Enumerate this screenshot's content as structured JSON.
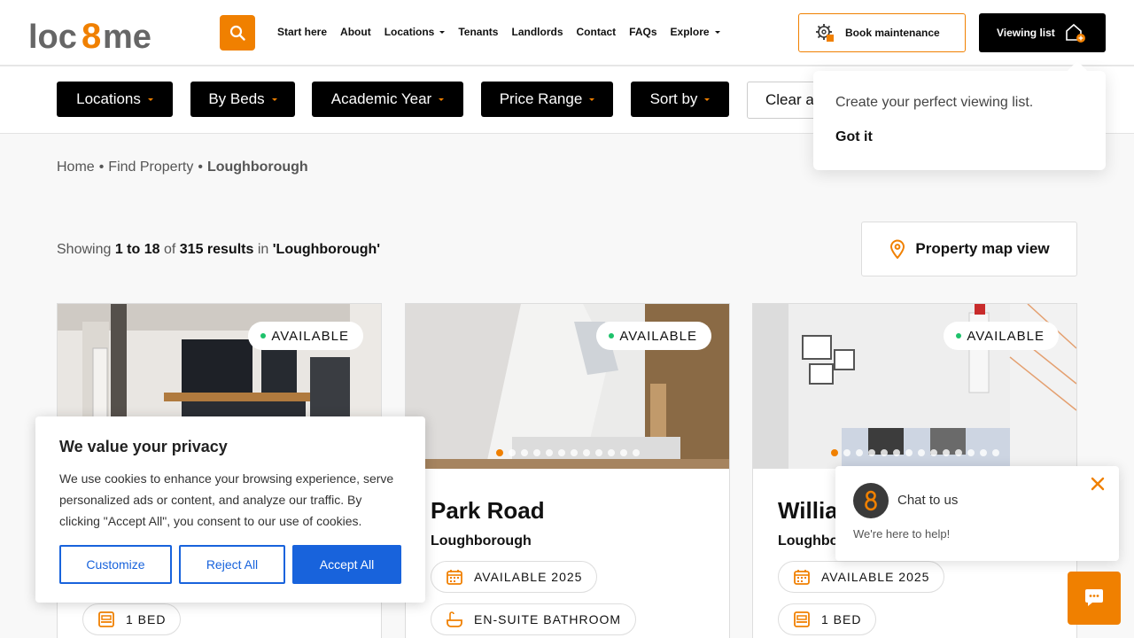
{
  "header": {
    "logo_text": "loc8me",
    "nav": [
      {
        "label": "Start here",
        "dropdown": false
      },
      {
        "label": "About",
        "dropdown": false
      },
      {
        "label": "Locations",
        "dropdown": true
      },
      {
        "label": "Tenants",
        "dropdown": false
      },
      {
        "label": "Landlords",
        "dropdown": false
      },
      {
        "label": "Contact",
        "dropdown": false
      },
      {
        "label": "FAQs",
        "dropdown": false
      },
      {
        "label": "Explore",
        "dropdown": true
      }
    ],
    "book_maintenance_label": "Book maintenance",
    "viewing_list_label": "Viewing list"
  },
  "filters": {
    "locations": "Locations",
    "by_beds": "By Beds",
    "academic_year": "Academic Year",
    "price_range": "Price Range",
    "sort_by": "Sort by",
    "clear": "Clear a"
  },
  "popover": {
    "message": "Create your perfect viewing list.",
    "dismiss": "Got it"
  },
  "breadcrumb": {
    "home": "Home",
    "find": "Find Property",
    "current": "Loughborough"
  },
  "results": {
    "prefix": "Showing",
    "range": "1 to 18",
    "of": "of",
    "total": "315 results",
    "in": "in",
    "query": "'Loughborough'"
  },
  "map_view_label": "Property map view",
  "cards": [
    {
      "status": "AVAILABLE",
      "title": "",
      "town": "",
      "pills": [
        "1 BED"
      ]
    },
    {
      "status": "AVAILABLE",
      "title": "Park Road",
      "town": "Loughborough",
      "pills": [
        "AVAILABLE 2025",
        "EN-SUITE BATHROOM"
      ]
    },
    {
      "status": "AVAILABLE",
      "title": "William",
      "town": "Loughbo",
      "pills": [
        "AVAILABLE 2025",
        "1 BED"
      ]
    }
  ],
  "cookie": {
    "title": "We value your privacy",
    "body": "We use cookies to enhance your browsing experience, serve personalized ads or content, and analyze our traffic. By clicking \"Accept All\", you consent to our use of cookies.",
    "customize": "Customize",
    "reject": "Reject All",
    "accept": "Accept All"
  },
  "chat": {
    "title": "Chat to us",
    "subtitle": "We're here to help!"
  },
  "colors": {
    "accent": "#f08000",
    "dark": "#000000",
    "cookie_blue": "#1863dc",
    "available_green": "#1ec26b"
  }
}
